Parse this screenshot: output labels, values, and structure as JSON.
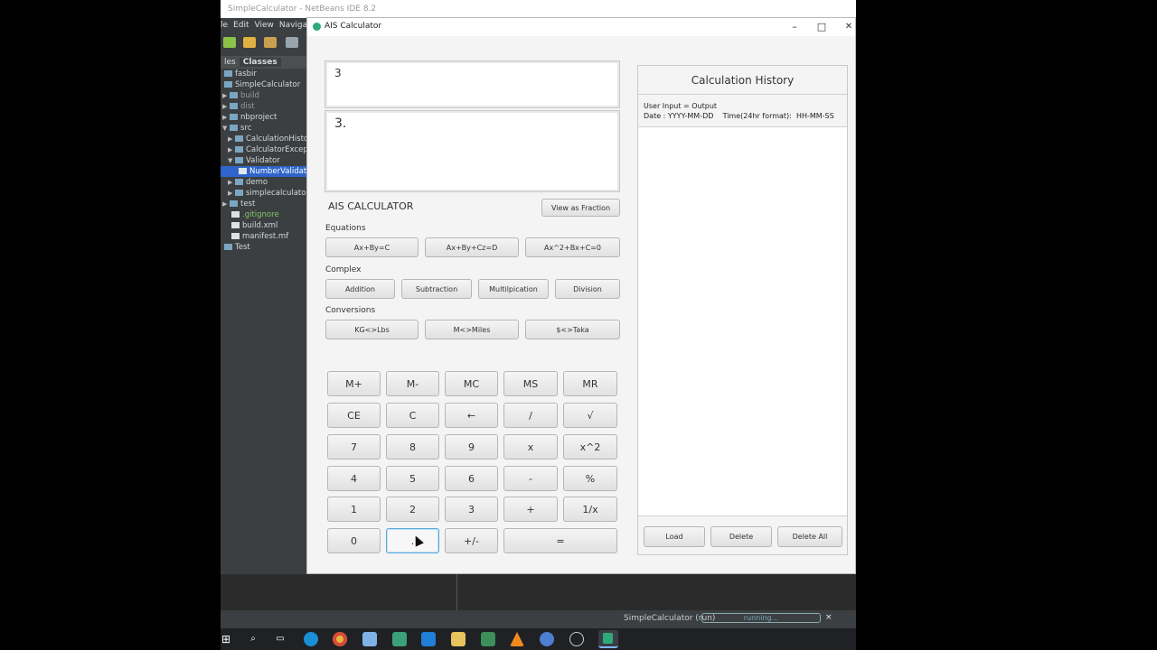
{
  "ide": {
    "title": "SimpleCalculator - NetBeans IDE 8.2",
    "menu": [
      "le",
      "Edit",
      "View",
      "Navigate"
    ],
    "tabs": [
      "les",
      "Classes"
    ],
    "tree": [
      {
        "label": "fasbir"
      },
      {
        "label": "SimpleCalculator"
      },
      {
        "label": "build"
      },
      {
        "label": "dist"
      },
      {
        "label": "nbproject"
      },
      {
        "label": "src"
      },
      {
        "label": "CalculationHistor"
      },
      {
        "label": "CalculatorExcepti"
      },
      {
        "label": "Validator"
      },
      {
        "label": "NumberValidato"
      },
      {
        "label": "demo"
      },
      {
        "label": "simplecalculator"
      },
      {
        "label": "test"
      },
      {
        "label": ".gitignore"
      },
      {
        "label": "build.xml"
      },
      {
        "label": "manifest.mf"
      },
      {
        "label": "Test"
      }
    ],
    "status": {
      "run_label": "SimpleCalculator (run)",
      "progress_text": "running...",
      "close": "×"
    }
  },
  "calculator": {
    "title": "AIS Calculator",
    "window_controls": {
      "minimize": "–",
      "maximize": "□",
      "close": "✕"
    },
    "input_display": "3",
    "result_display": "3.",
    "heading": "AIS CALCULATOR",
    "view_fraction_label": "View as Fraction",
    "sections": {
      "equations": {
        "label": "Equations",
        "buttons": [
          "Ax+By=C",
          "Ax+By+Cz=D",
          "Ax^2+Bx+C=0"
        ]
      },
      "complex": {
        "label": "Complex",
        "buttons": [
          "Addition",
          "Subtraction",
          "Multilpication",
          "Division"
        ]
      },
      "conversions": {
        "label": "Conversions",
        "buttons": [
          "KG<>Lbs",
          "M<>Miles",
          "$<>Taka"
        ]
      }
    },
    "keypad": [
      [
        "M+",
        "M-",
        "MC",
        "MS",
        "MR"
      ],
      [
        "CE",
        "C",
        "←",
        "/",
        "√"
      ],
      [
        "7",
        "8",
        "9",
        "x",
        "x^2"
      ],
      [
        "4",
        "5",
        "6",
        "-",
        "%"
      ],
      [
        "1",
        "2",
        "3",
        "+",
        "1/x"
      ],
      [
        "0",
        ".",
        "+/-",
        "="
      ]
    ],
    "history": {
      "title": "Calculation History",
      "info_line1": "User Input = Output",
      "info_line2": "Date : YYYY-MM-DD    Time(24hr format):  HH-MM-SS",
      "buttons": [
        "Load",
        "Delete",
        "Delete All"
      ]
    }
  }
}
